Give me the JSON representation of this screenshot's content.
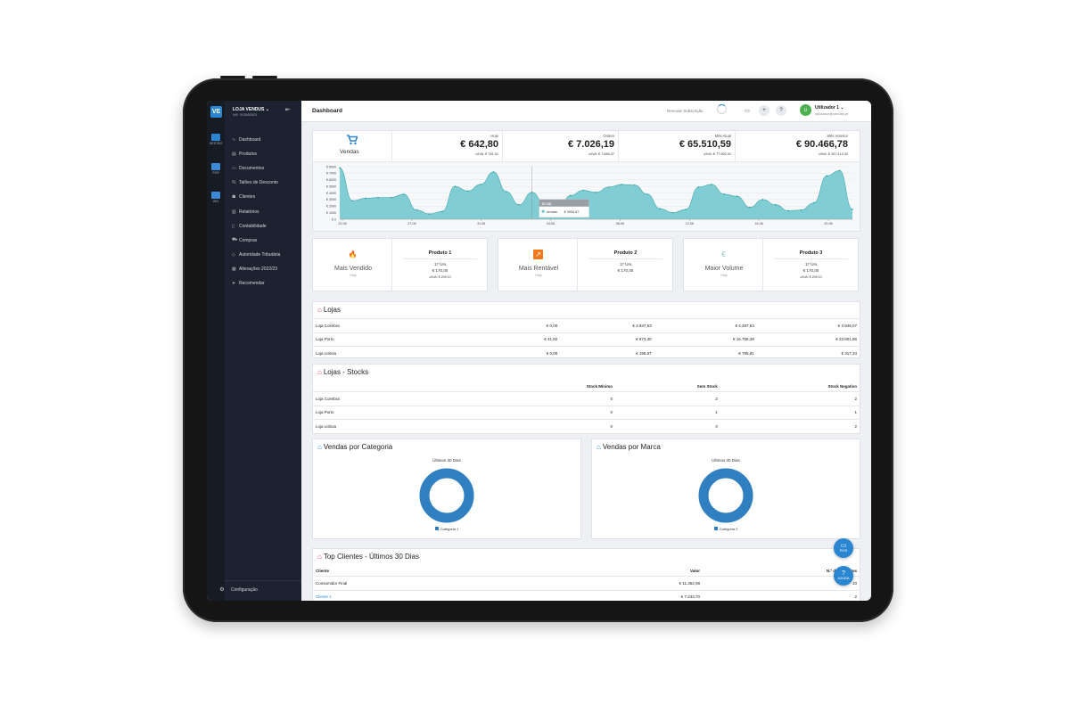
{
  "app": {
    "logo": "VE",
    "store_name": "LOJA VENDUS ⌄",
    "store_nif": "NIF: 503580523"
  },
  "rail": [
    {
      "label": "GESTÃO",
      "icon": "management-icon"
    },
    {
      "label": "POS",
      "icon": "pos-icon"
    },
    {
      "label": "ISO",
      "icon": "iso-icon"
    }
  ],
  "menu": [
    {
      "label": "Dashboard",
      "icon": "pulse-icon",
      "glyph": "∿"
    },
    {
      "label": "Produtos",
      "icon": "box-icon",
      "glyph": "▤"
    },
    {
      "label": "Documentos",
      "icon": "folder-icon",
      "glyph": "▭"
    },
    {
      "label": "Talões de Desconto",
      "icon": "percent-icon",
      "glyph": "%"
    },
    {
      "label": "Clientes",
      "icon": "users-icon",
      "glyph": "☗"
    },
    {
      "label": "Relatórios",
      "icon": "bar-chart-icon",
      "glyph": "▥"
    },
    {
      "label": "Contabilidade",
      "icon": "file-icon",
      "glyph": "▯"
    },
    {
      "label": "Compras",
      "icon": "truck-icon",
      "glyph": "⛟"
    },
    {
      "label": "Autoridade Tributária",
      "icon": "shield-icon",
      "glyph": "◇"
    },
    {
      "label": "Alterações 2022/23",
      "icon": "grid-icon",
      "glyph": "▦"
    },
    {
      "label": "Recomendar",
      "icon": "send-icon",
      "glyph": "➤"
    }
  ],
  "config": {
    "label": "Configuração",
    "glyph": "⚙"
  },
  "topbar": {
    "title": "Dashboard",
    "renew": "Renovar Subscrição",
    "user_initial": "U",
    "user_name": "Utilizador 1 ⌄",
    "user_email": "utilizador@vendus.pt"
  },
  "sales": {
    "label": "Vendas",
    "kpis": [
      {
        "label": "Hoje",
        "value": "€ 642,80",
        "sub": "c/IVA: € 781,91"
      },
      {
        "label": "Ontem",
        "value": "€ 7.026,19",
        "sub": "c/IVA: € 7.684,37"
      },
      {
        "label": "Mês Atual",
        "value": "€ 65.510,59",
        "sub": "c/IVA: € 77.992,01"
      },
      {
        "label": "Mês Anterior",
        "value": "€ 90.466,78",
        "sub": "c/IVA: € 107.413,32"
      }
    ]
  },
  "chart_data": {
    "type": "area",
    "y_ticks": [
      "€ 8000",
      "€ 7000",
      "€ 6000",
      "€ 5000",
      "€ 4000",
      "€ 3000",
      "€ 2000",
      "€ 1000",
      "€ 0"
    ],
    "ylim": [
      0,
      8000
    ],
    "x_ticks": [
      "23-05",
      "27-05",
      "31-05",
      "04-06",
      "08-06",
      "12-06",
      "16-06",
      "20-06"
    ],
    "series": [
      {
        "name": "vendas",
        "values": [
          7800,
          2800,
          3200,
          3300,
          3300,
          3800,
          1400,
          800,
          1200,
          5000,
          4300,
          5300,
          7200,
          4200,
          2200,
          4100,
          2300,
          1200,
          3600,
          4400,
          4100,
          4900,
          5300,
          5200,
          3800,
          1600,
          1000,
          1500,
          4900,
          5300,
          3800,
          3500,
          1800,
          3000,
          2200,
          1300,
          1400,
          2500,
          6600,
          7400,
          1500
        ]
      }
    ],
    "tooltip": {
      "date": "07-06",
      "series": "vendas",
      "value": "€ 3934.87"
    },
    "color": "#6cc6cc"
  },
  "products": [
    {
      "label": "Mais Vendido",
      "period": "Hoje",
      "icon": "fire-icon",
      "product": "Produto 1",
      "units": "17 Uni",
      "value": "€ 170,00",
      "vat": "c/IVA: € 209,10"
    },
    {
      "label": "Mais Rentável",
      "period": "Hoje",
      "icon": "trending-up-icon",
      "product": "Produto 2",
      "units": "17 Uni",
      "value": "€ 170,00",
      "vat": ""
    },
    {
      "label": "Maior Volume",
      "period": "Hoje",
      "icon": "euro-icon",
      "product": "Produto 3",
      "units": "17 Uni",
      "value": "€ 170,00",
      "vat": "c/IVA: € 209,10"
    }
  ],
  "lojas": {
    "title": "Lojas",
    "rows": [
      {
        "name": "Loja Coimbra",
        "c1": "€ 0,00",
        "c2": "€ 3.937,63",
        "c3": "€ 4.287,63",
        "c4": "€ 3.946,07"
      },
      {
        "name": "Loja Porto",
        "c1": "€ 41,82",
        "c2": "€ 873,30",
        "c3": "€ 16.756,38",
        "c4": "€ 23.801,86"
      },
      {
        "name": "Loja Lisboa",
        "c1": "€ 0,00",
        "c2": "€ 195,57",
        "c3": "€ 795,81",
        "c4": "€ 317,34"
      }
    ]
  },
  "stocks": {
    "title": "Lojas - Stocks",
    "headers": [
      "Stock Mínimo",
      "Sem Stock",
      "Stock Negativo"
    ],
    "rows": [
      {
        "name": "Loja Coimbra",
        "min": "0",
        "none": "2",
        "neg": "2"
      },
      {
        "name": "Loja Porto",
        "min": "0",
        "none": "1",
        "neg": "1"
      },
      {
        "name": "Loja Lisboa",
        "min": "0",
        "none": "3",
        "neg": "2"
      }
    ]
  },
  "cat_chart": {
    "title": "Vendas por Categoria",
    "subtitle": "Últimos 30 Dias",
    "legend": "Categoria 1"
  },
  "brand_chart": {
    "title": "Vendas por Marca",
    "subtitle": "Últimos 30 Dias",
    "legend": "Categoria 2"
  },
  "top_clients": {
    "title": "Top Clientes - Últimos 30 Dias",
    "headers": [
      "Cliente",
      "Valor",
      "N.º documentos"
    ],
    "rows": [
      {
        "name": "Consumidor Final",
        "value": "€ 11.362,08",
        "docs": "10"
      },
      {
        "name": "Cliente 1",
        "value": "€ 7.233,70",
        "docs": "2"
      }
    ]
  },
  "fabs": [
    {
      "label": "POS",
      "glyph": "▭"
    },
    {
      "label": "AJUDA",
      "glyph": "?"
    }
  ],
  "colors": {
    "accent": "#2a86d1",
    "area": "#6cc6cc",
    "home_red": "#e53950",
    "sidebar": "#1d2230",
    "donut": "#2f7fc1"
  }
}
